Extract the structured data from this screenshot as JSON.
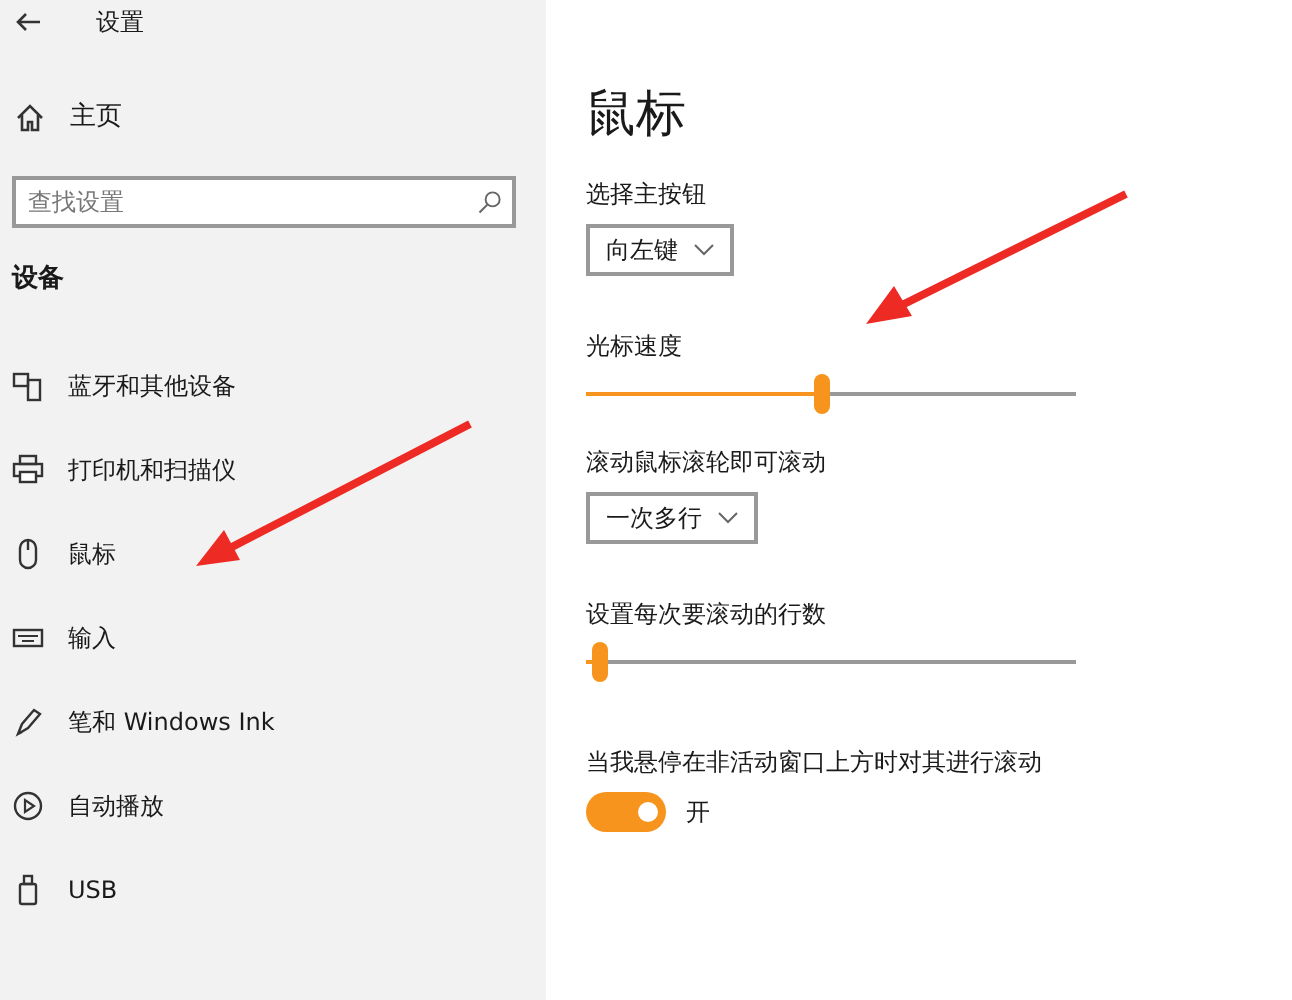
{
  "window": {
    "title": "设置"
  },
  "sidebar": {
    "home": "主页",
    "search": {
      "placeholder": "查找设置"
    },
    "section": "设备",
    "items": [
      {
        "label": "蓝牙和其他设备",
        "kind": "bluetooth"
      },
      {
        "label": "打印机和扫描仪",
        "kind": "printer"
      },
      {
        "label": "鼠标",
        "kind": "mouse"
      },
      {
        "label": "输入",
        "kind": "keyboard"
      },
      {
        "label": "笔和 Windows Ink",
        "kind": "pen"
      },
      {
        "label": "自动播放",
        "kind": "autoplay"
      },
      {
        "label": "USB",
        "kind": "usb"
      }
    ]
  },
  "page": {
    "title": "鼠标",
    "settings": [
      {
        "kind": "dropdown",
        "label": "选择主按钮",
        "value": "向左键"
      },
      {
        "kind": "slider",
        "label": "光标速度",
        "level": 0.48
      },
      {
        "kind": "dropdown",
        "label": "滚动鼠标滚轮即可滚动",
        "value": "一次多行"
      },
      {
        "kind": "slider",
        "label": "设置每次要滚动的行数",
        "level": 0.03
      },
      {
        "kind": "toggle",
        "label": "当我悬停在非活动窗口上方时对其进行滚动",
        "on": true,
        "state_label": "开"
      }
    ]
  }
}
